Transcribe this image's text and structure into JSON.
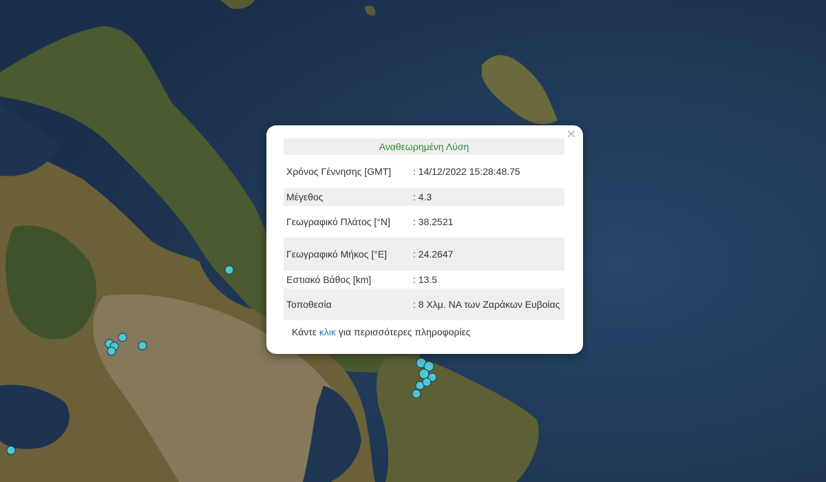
{
  "map": {
    "colors": {
      "sea": "#1e3652",
      "land": "#5c5a33",
      "forest": "#2f4a24",
      "urban": "#8a7b63",
      "marker": "#4ec6d6"
    },
    "markers": [
      {
        "id": "eq-1",
        "lat": 38.38,
        "lon": 23.93
      },
      {
        "id": "eq-2",
        "lat": 38.1,
        "lon": 23.1
      },
      {
        "id": "eq-3",
        "lat": 38.11,
        "lon": 23.13
      },
      {
        "id": "eq-4",
        "lat": 38.09,
        "lon": 23.21
      },
      {
        "id": "eq-5",
        "lat": 38.08,
        "lon": 23.12
      },
      {
        "id": "eq-6",
        "lat": 37.99,
        "lon": 22.55
      },
      {
        "id": "eq-7",
        "lat": 38.25,
        "lon": 24.26
      },
      {
        "id": "eq-8",
        "lat": 38.24,
        "lon": 24.27
      },
      {
        "id": "eq-9",
        "lat": 38.23,
        "lon": 24.25
      },
      {
        "id": "eq-10",
        "lat": 38.22,
        "lon": 24.26
      },
      {
        "id": "eq-11",
        "lat": 38.21,
        "lon": 24.25
      },
      {
        "id": "eq-12",
        "lat": 38.2,
        "lon": 24.24
      }
    ]
  },
  "popup": {
    "title": "Αναθεωρημένη Λύση",
    "rows": [
      {
        "label": "Χρόνος Γέννησης [GMT]",
        "value": ": 14/12/2022 15:28:48.75"
      },
      {
        "label": "Μέγεθος",
        "value": ": 4.3"
      },
      {
        "label": "Γεωγραφικό Πλάτος [°N]",
        "value": ": 38.2521"
      },
      {
        "label": "Γεωγραφικό Μήκος [°E]",
        "value": ": 24.2647"
      },
      {
        "label": "Εστιακό Βάθος [km]",
        "value": ": 13.5"
      },
      {
        "label": "Τοποθεσία",
        "value": ": 8 Χλμ. ΝΑ των Ζαράκων Ευβοίας"
      }
    ],
    "more": {
      "prefix": "Κάντε ",
      "link": "κλικ",
      "suffix": " για περισσότερες πληροφορίες"
    },
    "close_icon": "×"
  }
}
